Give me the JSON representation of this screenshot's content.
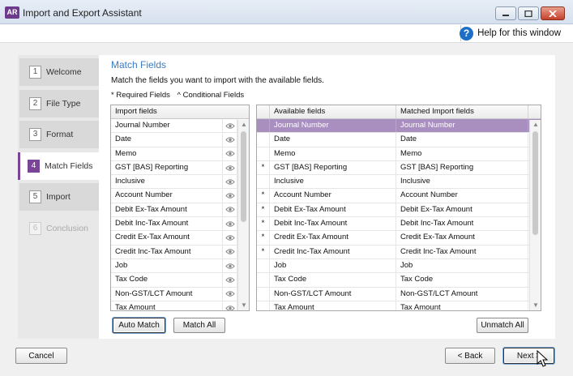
{
  "window": {
    "app_badge": "AR",
    "title": "Import and Export Assistant"
  },
  "help": {
    "label": "Help for this window",
    "icon_glyph": "?"
  },
  "steps": [
    {
      "num": "1",
      "label": "Welcome",
      "state": "normal"
    },
    {
      "num": "2",
      "label": "File Type",
      "state": "normal"
    },
    {
      "num": "3",
      "label": "Format",
      "state": "normal"
    },
    {
      "num": "4",
      "label": "Match Fields",
      "state": "active"
    },
    {
      "num": "5",
      "label": "Import",
      "state": "normal"
    },
    {
      "num": "6",
      "label": "Conclusion",
      "state": "disabled"
    }
  ],
  "panel": {
    "title": "Match Fields",
    "instructions": "Match the fields you want to import with the available fields.",
    "legend_required": "* Required Fields",
    "legend_conditional": "^ Conditional Fields"
  },
  "import_fields": {
    "header": "Import fields",
    "rows": [
      "Journal Number",
      "Date",
      "Memo",
      "GST [BAS] Reporting",
      "Inclusive",
      "Account Number",
      "Debit Ex-Tax Amount",
      "Debit Inc-Tax Amount",
      "Credit Ex-Tax Amount",
      "Credit Inc-Tax Amount",
      "Job",
      "Tax Code",
      "Non-GST/LCT Amount",
      "Tax Amount"
    ]
  },
  "available_fields": {
    "header_available": "Available fields",
    "header_matched": "Matched Import fields",
    "rows": [
      {
        "mark": "",
        "available": "Journal Number",
        "matched": "Journal Number",
        "selected": true
      },
      {
        "mark": "",
        "available": "Date",
        "matched": "Date"
      },
      {
        "mark": "",
        "available": "Memo",
        "matched": "Memo"
      },
      {
        "mark": "*",
        "available": "GST [BAS] Reporting",
        "matched": "GST [BAS] Reporting"
      },
      {
        "mark": "",
        "available": "Inclusive",
        "matched": "Inclusive"
      },
      {
        "mark": "*",
        "available": "Account Number",
        "matched": "Account Number"
      },
      {
        "mark": "*",
        "available": "Debit Ex-Tax Amount",
        "matched": "Debit Ex-Tax Amount"
      },
      {
        "mark": "*",
        "available": "Debit Inc-Tax Amount",
        "matched": "Debit Inc-Tax Amount"
      },
      {
        "mark": "*",
        "available": "Credit Ex-Tax Amount",
        "matched": "Credit Ex-Tax Amount"
      },
      {
        "mark": "*",
        "available": "Credit Inc-Tax Amount",
        "matched": "Credit Inc-Tax Amount"
      },
      {
        "mark": "",
        "available": "Job",
        "matched": "Job"
      },
      {
        "mark": "",
        "available": "Tax Code",
        "matched": "Tax Code"
      },
      {
        "mark": "",
        "available": "Non-GST/LCT Amount",
        "matched": "Non-GST/LCT Amount"
      },
      {
        "mark": "",
        "available": "Tax Amount",
        "matched": "Tax Amount"
      }
    ]
  },
  "buttons": {
    "auto_match": "Auto Match",
    "match_all": "Match All",
    "unmatch_all": "Unmatch All",
    "cancel": "Cancel",
    "back": "< Back",
    "next": "Next >"
  },
  "colors": {
    "accent_purple": "#7b4597",
    "selected_row": "#a98fc0",
    "title_blue": "#3b7cbf",
    "help_blue": "#1c6fc4"
  }
}
